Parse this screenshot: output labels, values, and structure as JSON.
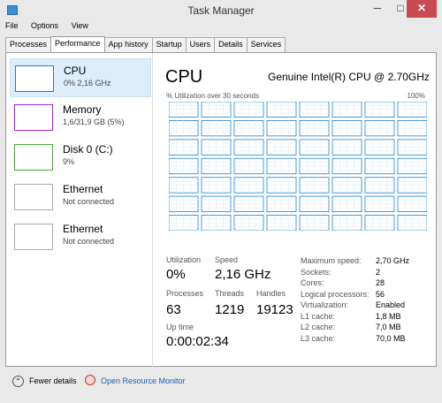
{
  "window": {
    "title": "Task Manager",
    "minimize": "─",
    "maximize": "□",
    "close": "✕"
  },
  "menu": [
    "File",
    "Options",
    "View"
  ],
  "tabs": [
    "Processes",
    "Performance",
    "App history",
    "Startup",
    "Users",
    "Details",
    "Services"
  ],
  "active_tab": "Performance",
  "sidebar": [
    {
      "name": "CPU",
      "sub": "0% 2,16 GHz",
      "color": "#1a7fc9",
      "selected": true
    },
    {
      "name": "Memory",
      "sub": "1,6/31,9 GB (5%)",
      "color": "#9b29b8",
      "selected": false
    },
    {
      "name": "Disk 0 (C:)",
      "sub": "9%",
      "color": "#4ca93c",
      "selected": false
    },
    {
      "name": "Ethernet",
      "sub": "Not connected",
      "color": "#aaaaaa",
      "selected": false
    },
    {
      "name": "Ethernet",
      "sub": "Not connected",
      "color": "#aaaaaa",
      "selected": false
    }
  ],
  "main": {
    "title": "CPU",
    "cpu_name": "Genuine Intel(R) CPU @ 2.70GHz",
    "graph_caption": "% Utilization over 30 seconds",
    "graph_max": "100%",
    "graph_color": "#1a7fc9",
    "graph_grid": {
      "rows": 7,
      "cols": 8
    }
  },
  "stats": {
    "utilization_label": "Utilization",
    "utilization": "0%",
    "speed_label": "Speed",
    "speed": "2,16 GHz",
    "processes_label": "Processes",
    "processes": "63",
    "threads_label": "Threads",
    "threads": "1219",
    "handles_label": "Handles",
    "handles": "19123",
    "uptime_label": "Up time",
    "uptime": "0:00:02:34"
  },
  "specs": [
    {
      "label": "Maximum speed:",
      "value": "2,70 GHz"
    },
    {
      "label": "Sockets:",
      "value": "2"
    },
    {
      "label": "Cores:",
      "value": "28"
    },
    {
      "label": "Logical processors:",
      "value": "56"
    },
    {
      "label": "Virtualization:",
      "value": "Enabled"
    },
    {
      "label": "L1 cache:",
      "value": "1,8 MB"
    },
    {
      "label": "L2 cache:",
      "value": "7,0 MB"
    },
    {
      "label": "L3 cache:",
      "value": "70,0 MB"
    }
  ],
  "footer": {
    "fewer_details": "Fewer details",
    "open_monitor": "Open Resource Monitor",
    "link_color": "#1a5fb4"
  }
}
